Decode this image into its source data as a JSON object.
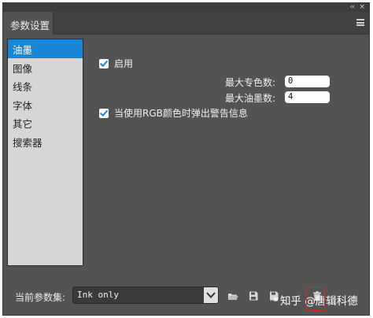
{
  "panel": {
    "tab_label": "参数设置",
    "collapse_glyph": "‹‹",
    "close_glyph": "×"
  },
  "categories": [
    {
      "label": "油墨",
      "selected": true
    },
    {
      "label": "图像",
      "selected": false
    },
    {
      "label": "线条",
      "selected": false
    },
    {
      "label": "字体",
      "selected": false
    },
    {
      "label": "其它",
      "selected": false
    },
    {
      "label": "搜索器",
      "selected": false
    }
  ],
  "options": {
    "enable_label": "启用",
    "enable_checked": true,
    "max_spot_label": "最大专色数:",
    "max_spot_value": "0",
    "max_ink_label": "最大油墨数:",
    "max_ink_value": "4",
    "rgb_warn_label": "当使用RGB颜色时弹出警告信息",
    "rgb_warn_checked": true
  },
  "bottom": {
    "preset_label": "当前参数集:",
    "preset_value": "Ink only"
  },
  "watermark": {
    "text": "知乎 @唐辑科德"
  },
  "colors": {
    "panel_bg": "#535353",
    "selected_item": "#1a86d8",
    "checkbox_mark": "#1a86d8",
    "highlight_box": "#cc2a2a"
  },
  "icons": [
    "collapse-icon",
    "close-icon",
    "panel-menu-icon",
    "checkmark-icon",
    "chevron-down-icon",
    "open-folder-icon",
    "save-icon",
    "save-as-icon",
    "delete-icon"
  ]
}
